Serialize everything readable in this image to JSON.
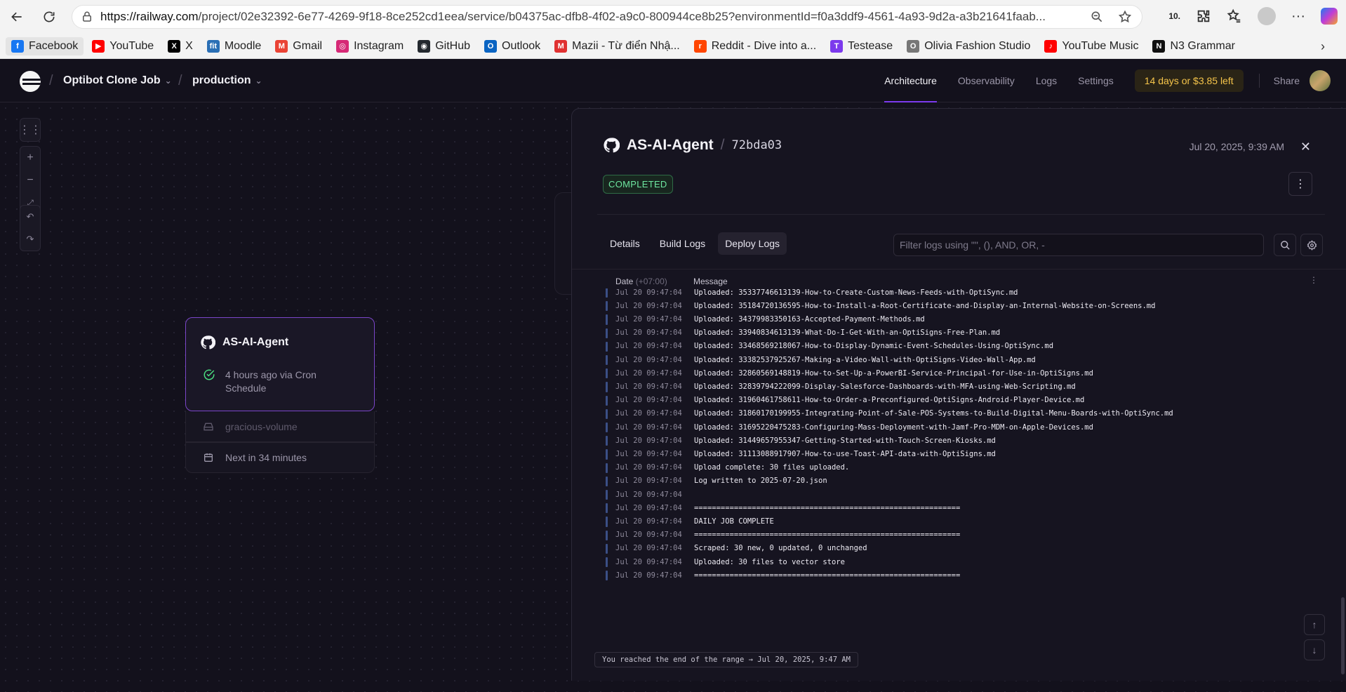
{
  "browser": {
    "url_host": "https://railway.com",
    "url_path": "/project/02e32392-6e77-4269-9f18-8ce252cd1eea/service/b04375ac-dfb8-4f02-a9c0-800944ce8b25?environmentId=f0a3ddf9-4561-4a93-9d2a-a3b21641faab...",
    "ext_badge": "10.",
    "bookmarks": [
      {
        "label": "Facebook",
        "color": "#1877f2",
        "glyph": "f"
      },
      {
        "label": "YouTube",
        "color": "#ff0000",
        "glyph": "▶"
      },
      {
        "label": "X",
        "color": "#000000",
        "glyph": "X"
      },
      {
        "label": "Moodle",
        "color": "#2a6fb5",
        "glyph": "fit"
      },
      {
        "label": "Gmail",
        "color": "#ea4335",
        "glyph": "M"
      },
      {
        "label": "Instagram",
        "color": "#d62976",
        "glyph": "◎"
      },
      {
        "label": "GitHub",
        "color": "#24292f",
        "glyph": "◉"
      },
      {
        "label": "Outlook",
        "color": "#0a64c2",
        "glyph": "O"
      },
      {
        "label": "Mazii - Từ điển Nhậ...",
        "color": "#e03131",
        "glyph": "M"
      },
      {
        "label": "Reddit - Dive into a...",
        "color": "#ff4500",
        "glyph": "r"
      },
      {
        "label": "Testease",
        "color": "#7c3aed",
        "glyph": "T"
      },
      {
        "label": "Olivia Fashion Studio",
        "color": "#777777",
        "glyph": "O"
      },
      {
        "label": "YouTube Music",
        "color": "#ff0000",
        "glyph": "♪"
      },
      {
        "label": "N3 Grammar",
        "color": "#111111",
        "glyph": "N"
      }
    ]
  },
  "app": {
    "project": "Optibot Clone Job",
    "environment": "production",
    "nav": [
      "Architecture",
      "Observability",
      "Logs",
      "Settings"
    ],
    "trial": "14 days or $3.85 left",
    "share": "Share"
  },
  "service_card": {
    "name": "AS-AI-Agent",
    "status": "4 hours ago via Cron Schedule",
    "volume": "gracious-volume",
    "next_run": "Next in 34 minutes"
  },
  "panel": {
    "service": "AS-AI-Agent",
    "slash": "/",
    "commit": "72bda03",
    "date": "Jul 20, 2025, 9:39 AM",
    "status": "COMPLETED",
    "tabs": [
      "Details",
      "Build Logs",
      "Deploy Logs"
    ],
    "filter_placeholder": "Filter logs using \"\", (), AND, OR, -",
    "col_date": "Date",
    "col_tz": "(+07:00)",
    "col_message": "Message",
    "end_note": "You reached the end of the range → Jul 20, 2025, 9:47 AM",
    "logs": [
      {
        "date": "Jul 20 09:47:04",
        "msg": "Uploaded: 35337746613139-How-to-Create-Custom-News-Feeds-with-OptiSync.md"
      },
      {
        "date": "Jul 20 09:47:04",
        "msg": "Uploaded: 35184720136595-How-to-Install-a-Root-Certificate-and-Display-an-Internal-Website-on-Screens.md"
      },
      {
        "date": "Jul 20 09:47:04",
        "msg": "Uploaded: 34379983350163-Accepted-Payment-Methods.md"
      },
      {
        "date": "Jul 20 09:47:04",
        "msg": "Uploaded: 33940834613139-What-Do-I-Get-With-an-OptiSigns-Free-Plan.md"
      },
      {
        "date": "Jul 20 09:47:04",
        "msg": "Uploaded: 33468569218067-How-to-Display-Dynamic-Event-Schedules-Using-OptiSync.md"
      },
      {
        "date": "Jul 20 09:47:04",
        "msg": "Uploaded: 33382537925267-Making-a-Video-Wall-with-OptiSigns-Video-Wall-App.md"
      },
      {
        "date": "Jul 20 09:47:04",
        "msg": "Uploaded: 32860569148819-How-to-Set-Up-a-PowerBI-Service-Principal-for-Use-in-OptiSigns.md"
      },
      {
        "date": "Jul 20 09:47:04",
        "msg": "Uploaded: 32839794222099-Display-Salesforce-Dashboards-with-MFA-using-Web-Scripting.md"
      },
      {
        "date": "Jul 20 09:47:04",
        "msg": "Uploaded: 31960461758611-How-to-Order-a-Preconfigured-OptiSigns-Android-Player-Device.md"
      },
      {
        "date": "Jul 20 09:47:04",
        "msg": "Uploaded: 31860170199955-Integrating-Point-of-Sale-POS-Systems-to-Build-Digital-Menu-Boards-with-OptiSync.md"
      },
      {
        "date": "Jul 20 09:47:04",
        "msg": "Uploaded: 31695220475283-Configuring-Mass-Deployment-with-Jamf-Pro-MDM-on-Apple-Devices.md"
      },
      {
        "date": "Jul 20 09:47:04",
        "msg": "Uploaded: 31449657955347-Getting-Started-with-Touch-Screen-Kiosks.md"
      },
      {
        "date": "Jul 20 09:47:04",
        "msg": "Uploaded: 31113088917907-How-to-use-Toast-API-data-with-OptiSigns.md"
      },
      {
        "date": "Jul 20 09:47:04",
        "msg": "Upload complete: 30 files uploaded."
      },
      {
        "date": "Jul 20 09:47:04",
        "msg": "Log written to 2025-07-20.json"
      },
      {
        "date": "Jul 20 09:47:04",
        "msg": ""
      },
      {
        "date": "Jul 20 09:47:04",
        "msg": "============================================================"
      },
      {
        "date": "Jul 20 09:47:04",
        "msg": "DAILY JOB COMPLETE"
      },
      {
        "date": "Jul 20 09:47:04",
        "msg": "============================================================"
      },
      {
        "date": "Jul 20 09:47:04",
        "msg": "Scraped: 30 new, 0 updated, 0 unchanged"
      },
      {
        "date": "Jul 20 09:47:04",
        "msg": "Uploaded: 30 files to vector store"
      },
      {
        "date": "Jul 20 09:47:04",
        "msg": "============================================================"
      }
    ]
  }
}
